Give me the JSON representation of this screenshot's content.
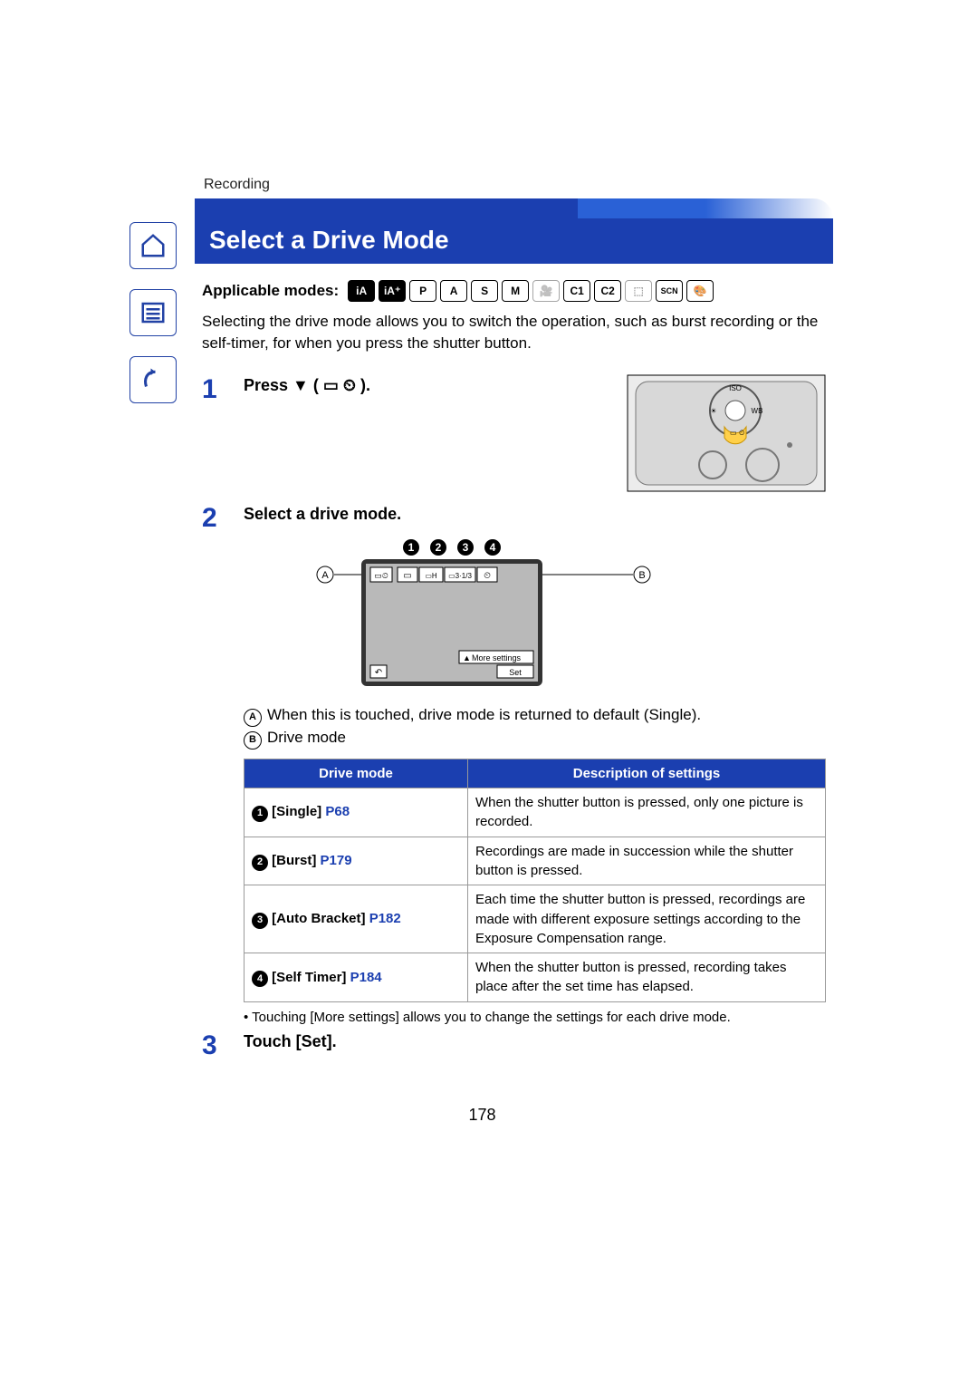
{
  "breadcrumb": "Recording",
  "title": "Select a Drive Mode",
  "applicable_label": "Applicable modes:",
  "modes": [
    "iA",
    "iA+",
    "P",
    "A",
    "S",
    "M",
    "video",
    "C1",
    "C2",
    "panorama",
    "SCN",
    "palette"
  ],
  "intro": "Selecting the drive mode allows you to switch the operation, such as burst recording or the self-timer, for when you press the shutter button.",
  "steps": {
    "s1_num": "1",
    "s1_title": "Press ▼ (",
    "s1_title_trail": ").",
    "s2_num": "2",
    "s2_title": "Select a drive mode.",
    "s3_num": "3",
    "s3_title": "Touch [Set]."
  },
  "screen": {
    "more_settings": "More settings",
    "set_label": "Set",
    "opt3_text": "3·1/3"
  },
  "legend": {
    "A": "When this is touched, drive mode is returned to default (Single).",
    "B": "Drive mode"
  },
  "table": {
    "head_mode": "Drive mode",
    "head_desc": "Description of settings",
    "rows": [
      {
        "num": "1",
        "name": "[Single]",
        "ref": "P68",
        "desc": "When the shutter button is pressed, only one picture is recorded."
      },
      {
        "num": "2",
        "name": "[Burst]",
        "ref": "P179",
        "desc": "Recordings are made in succession while the shutter button is pressed."
      },
      {
        "num": "3",
        "name": "[Auto Bracket]",
        "ref": "P182",
        "desc": "Each time the shutter button is pressed, recordings are made with different exposure settings according to the Exposure Compensation range."
      },
      {
        "num": "4",
        "name": "[Self Timer]",
        "ref": "P184",
        "desc": "When the shutter button is pressed, recording takes place after the set time has elapsed."
      }
    ]
  },
  "footnote": "• Touching [More settings] allows you to change the settings for each drive mode.",
  "page_number": "178"
}
